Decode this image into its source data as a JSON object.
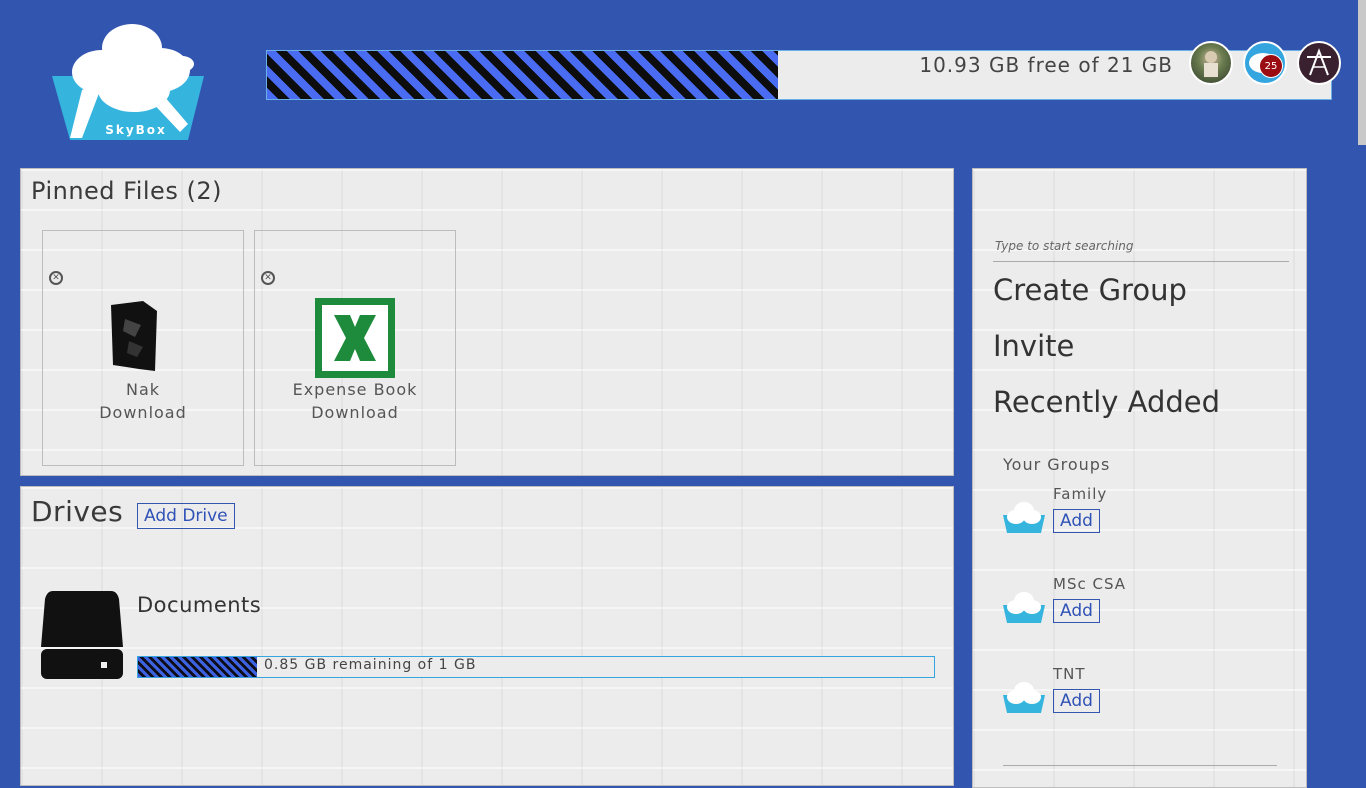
{
  "brand": {
    "name": "SkyBox",
    "icon": "skybox-cloud-logo"
  },
  "header": {
    "storage_text": "10.93 GB free of 21 GB",
    "storage_used_fraction": 0.48,
    "notification_count": "25",
    "icons": [
      "avatar",
      "notification-icon",
      "settings-icon"
    ]
  },
  "pinned": {
    "title": "Pinned Files (2)",
    "files": [
      {
        "name": "Nak",
        "download_label": "Download",
        "icon": "black-file-icon"
      },
      {
        "name": "Expense Book",
        "download_label": "Download",
        "icon": "excel-icon"
      }
    ]
  },
  "drives": {
    "title": "Drives",
    "add_label": "Add Drive",
    "items": [
      {
        "name": "Documents",
        "bar_text": "0.85 GB remaining of 1 GB",
        "used_fraction": 0.15,
        "icon": "hard-drive-icon"
      }
    ]
  },
  "sidebar": {
    "search_placeholder": "Type to start searching",
    "links": [
      "Create Group",
      "Invite",
      "Recently Added"
    ],
    "groups_title": "Your Groups",
    "groups": [
      {
        "name": "Family",
        "add_label": "Add"
      },
      {
        "name": "MSc CSA",
        "add_label": "Add"
      },
      {
        "name": "TNT",
        "add_label": "Add"
      }
    ]
  },
  "colors": {
    "background": "#3255b0",
    "accent": "#35a5e0",
    "badge": "#9a0b12",
    "excel": "#1e8a3c"
  }
}
